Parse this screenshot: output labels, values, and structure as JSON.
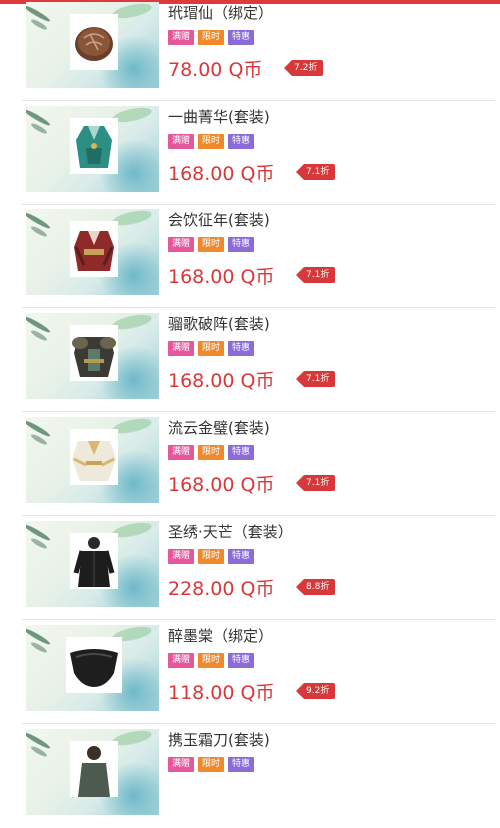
{
  "tags": [
    "满赠",
    "限时",
    "特惠"
  ],
  "currency": "Q币",
  "items": [
    {
      "name": "玳瑁仙（绑定）",
      "price": "78.00",
      "discount": "7.2折",
      "icon": "jade-coin-icon"
    },
    {
      "name": "一曲菁华(套装)",
      "price": "168.00",
      "discount": "7.1折",
      "icon": "green-robe-icon"
    },
    {
      "name": "会饮征年(套装)",
      "price": "168.00",
      "discount": "7.1折",
      "icon": "red-armor-icon"
    },
    {
      "name": "骝歌破阵(套装)",
      "price": "168.00",
      "discount": "7.1折",
      "icon": "dark-armor-icon"
    },
    {
      "name": "流云金璧(套装)",
      "price": "168.00",
      "discount": "7.1折",
      "icon": "white-gold-robe-icon"
    },
    {
      "name": "圣绣·天芒（套装）",
      "price": "228.00",
      "discount": "8.8折",
      "icon": "black-outfit-icon"
    },
    {
      "name": "醉墨棠（绑定）",
      "price": "118.00",
      "discount": "9.2折",
      "icon": "black-mask-icon"
    },
    {
      "name": "携玉霜刀(套装)",
      "price": "",
      "discount": "",
      "icon": "swordsman-icon"
    }
  ],
  "colors": {
    "accent": "#d8383a",
    "tag1": "#e2589a",
    "tag2": "#ef8a2c",
    "tag3": "#8a6bd8"
  }
}
